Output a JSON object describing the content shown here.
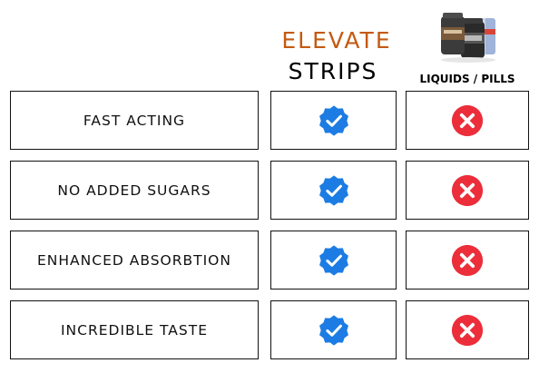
{
  "header": {
    "brand_line1": "ELEVATE",
    "brand_line2": "STRIPS",
    "alternative_label": "LIQUIDS / PILLS",
    "product_image_icon": "supplement-bottles-and-can-image"
  },
  "rows": [
    {
      "label": "FAST ACTING",
      "strips": "check-badge-icon",
      "liquids_pills": "x-circle-icon"
    },
    {
      "label": "NO ADDED SUGARS",
      "strips": "check-badge-icon",
      "liquids_pills": "x-circle-icon"
    },
    {
      "label": "ENHANCED ABSORBTION",
      "strips": "check-badge-icon",
      "liquids_pills": "x-circle-icon"
    },
    {
      "label": "INCREDIBLE TASTE",
      "strips": "check-badge-icon",
      "liquids_pills": "x-circle-icon"
    }
  ],
  "colors": {
    "brand_orange": "#c55a11",
    "check_blue": "#1c7ce3",
    "x_red": "#ec2e3a",
    "border": "#111111"
  }
}
